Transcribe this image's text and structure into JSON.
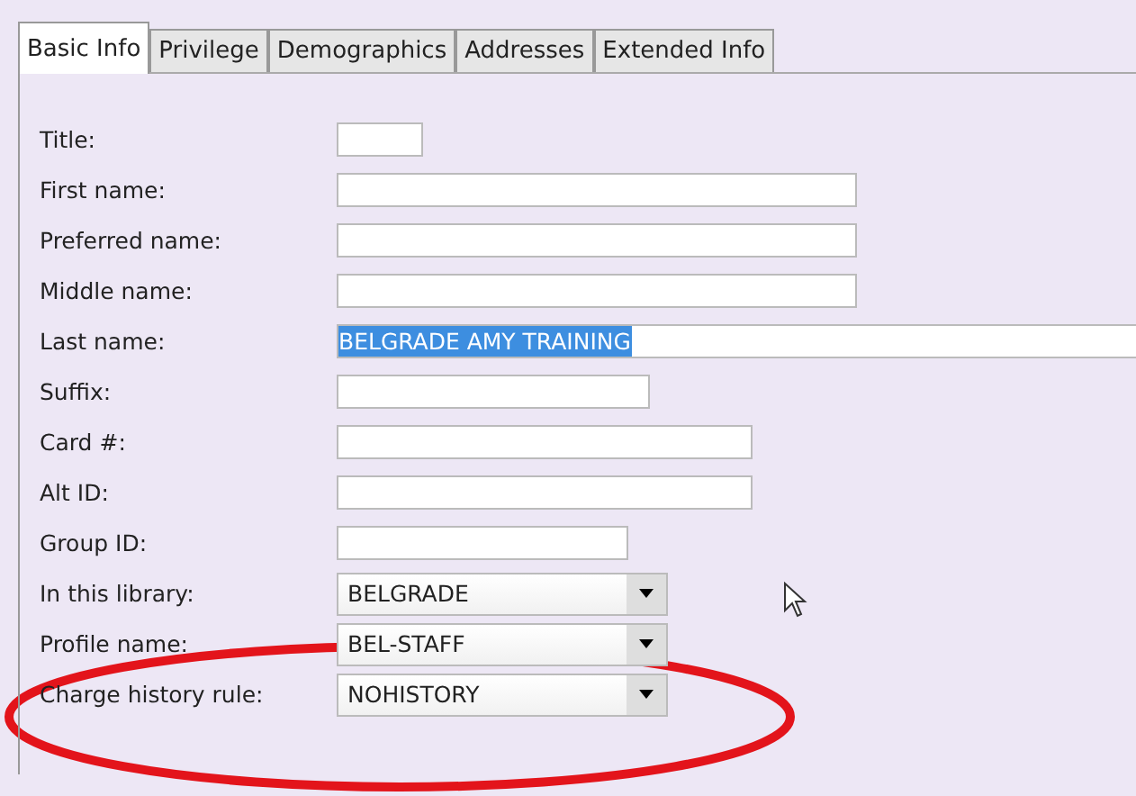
{
  "tabs": [
    {
      "label": "Basic Info",
      "selected": true
    },
    {
      "label": "Privilege",
      "selected": false
    },
    {
      "label": "Demographics",
      "selected": false
    },
    {
      "label": "Addresses",
      "selected": false
    },
    {
      "label": "Extended Info",
      "selected": false
    }
  ],
  "fields": [
    {
      "label": "Title:",
      "kind": "text"
    },
    {
      "label": "First name:",
      "kind": "text"
    },
    {
      "label": "Preferred name:",
      "kind": "text"
    },
    {
      "label": "Middle name:",
      "kind": "text"
    },
    {
      "label": "Last name:",
      "kind": "text",
      "value": "BELGRADE AMY TRAINING",
      "selected": true
    },
    {
      "label": "Suffix:",
      "kind": "text"
    },
    {
      "label": "Card #:",
      "kind": "text"
    },
    {
      "label": "Alt ID:",
      "kind": "text"
    },
    {
      "label": "Group ID:",
      "kind": "text"
    },
    {
      "label": "In this library:",
      "kind": "select",
      "value": "BELGRADE"
    },
    {
      "label": "Profile name:",
      "kind": "select",
      "value": "BEL-STAFF"
    },
    {
      "label": "Charge history rule:",
      "kind": "select",
      "value": "NOHISTORY"
    }
  ]
}
